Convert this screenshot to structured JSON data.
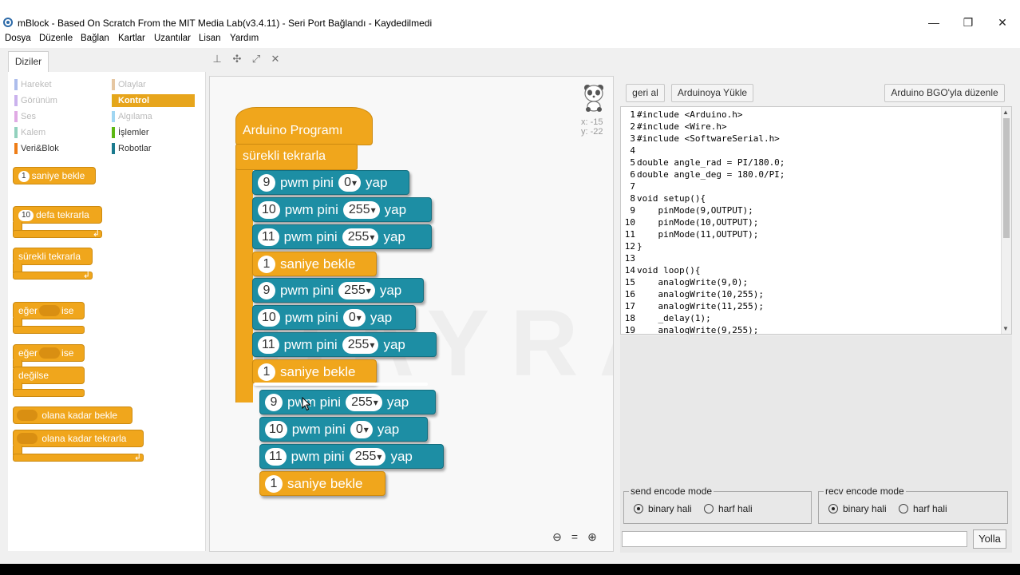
{
  "window": {
    "title": "mBlock - Based On Scratch From the MIT Media Lab(v3.4.11) - Seri Port Bağlandı - Kaydedilmedi",
    "minimize": "—",
    "maximize": "❐",
    "close": "✕"
  },
  "menu": [
    "Dosya",
    "Düzenle",
    "Bağlan",
    "Kartlar",
    "Uzantılar",
    "Lisan",
    "Yardım"
  ],
  "tab": "Diziler",
  "categories": [
    {
      "label": "Hareket",
      "color": "#4a6cd4"
    },
    {
      "label": "Olaylar",
      "color": "#c88330"
    },
    {
      "label": "Görünüm",
      "color": "#8a55d7"
    },
    {
      "label": "Kontrol",
      "color": "#e1a91a"
    },
    {
      "label": "Ses",
      "color": "#bb42c3"
    },
    {
      "label": "Algılama",
      "color": "#2ca5e2"
    },
    {
      "label": "Kalem",
      "color": "#0e9a6c"
    },
    {
      "label": "İşlemler",
      "color": "#5cb712"
    },
    {
      "label": "Veri&Blok",
      "color": "#ee7d16"
    },
    {
      "label": "Robotlar",
      "color": "#1a7a8e"
    }
  ],
  "palette": {
    "wait": {
      "num": "1",
      "label": "saniye bekle"
    },
    "repeat": {
      "num": "10",
      "label": "defa tekrarla"
    },
    "forever": "sürekli tekrarla",
    "if1": {
      "a": "eğer",
      "b": "ise"
    },
    "if2": {
      "a": "eğer",
      "b": "ise",
      "else": "değilse"
    },
    "wait_until": "olana kadar bekle",
    "repeat_until": "olana kadar tekrarla",
    "loop_arrow": "↲"
  },
  "script": {
    "hat": "Arduino Programı",
    "forever": "sürekli tekrarla",
    "pwm_a": "pwm pini",
    "pwm_b": "yap",
    "wait_label": "saniye bekle",
    "blocks": [
      {
        "pin": "9",
        "value": "0"
      },
      {
        "pin": "10",
        "value": "255"
      },
      {
        "pin": "11",
        "value": "255"
      },
      {
        "wait": "1"
      },
      {
        "pin": "9",
        "value": "255"
      },
      {
        "pin": "10",
        "value": "0"
      },
      {
        "pin": "11",
        "value": "255"
      },
      {
        "wait": "1"
      }
    ],
    "dragged": [
      {
        "pin": "9",
        "value": "255"
      },
      {
        "pin": "10",
        "value": "0"
      },
      {
        "pin": "11",
        "value": "255"
      },
      {
        "wait": "1"
      }
    ],
    "coord_x": "x: -15",
    "coord_y": "y: -22",
    "watermark": "BAYRAM YAPICI"
  },
  "buttons": {
    "undo": "geri al",
    "upload": "Arduinoya Yükle",
    "edit": "Arduino BGO'yla düzenle",
    "send": "Yolla"
  },
  "code": [
    {
      "n": "1",
      "t": "#include <Arduino.h>"
    },
    {
      "n": "2",
      "t": "#include <Wire.h>"
    },
    {
      "n": "3",
      "t": "#include <SoftwareSerial.h>"
    },
    {
      "n": "4",
      "t": ""
    },
    {
      "n": "5",
      "t": "double angle_rad = PI/180.0;"
    },
    {
      "n": "6",
      "t": "double angle_deg = 180.0/PI;"
    },
    {
      "n": "7",
      "t": ""
    },
    {
      "n": "8",
      "t": "void setup(){"
    },
    {
      "n": "9",
      "t": "    pinMode(9,OUTPUT);"
    },
    {
      "n": "10",
      "t": "    pinMode(10,OUTPUT);"
    },
    {
      "n": "11",
      "t": "    pinMode(11,OUTPUT);"
    },
    {
      "n": "12",
      "t": "}"
    },
    {
      "n": "13",
      "t": ""
    },
    {
      "n": "14",
      "t": "void loop(){"
    },
    {
      "n": "15",
      "t": "    analogWrite(9,0);"
    },
    {
      "n": "16",
      "t": "    analogWrite(10,255);"
    },
    {
      "n": "17",
      "t": "    analogWrite(11,255);"
    },
    {
      "n": "18",
      "t": "    _delay(1);"
    },
    {
      "n": "19",
      "t": "    analogWrite(9,255);"
    }
  ],
  "send_mode": {
    "legend": "send encode mode",
    "opt1": "binary hali",
    "opt2": "harf hali"
  },
  "recv_mode": {
    "legend": "recv encode mode",
    "opt1": "binary hali",
    "opt2": "harf hali"
  }
}
